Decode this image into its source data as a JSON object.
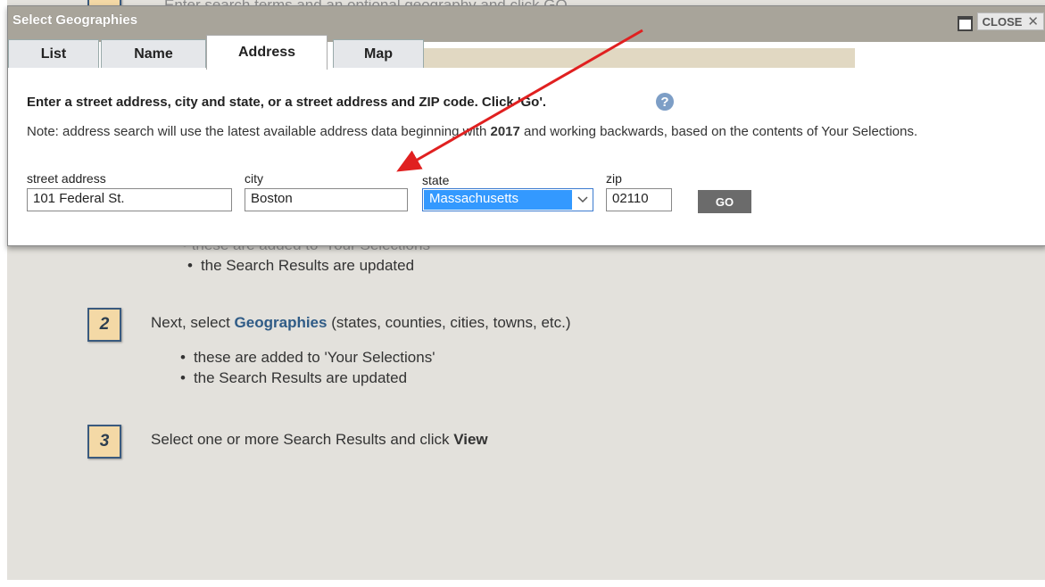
{
  "background": {
    "header_text": "Enter search terms and an optional geography and click GO",
    "step1_faded_bullet": "these are added to 'Your Selections'",
    "step1_bullet2": "the Search Results are updated",
    "step2": {
      "number": "2",
      "text_prefix": "Next, select ",
      "highlight": "Geographies",
      "text_suffix": " (states, counties, cities, towns, etc.)",
      "bullets": [
        "these are added to 'Your Selections'",
        "the Search Results are updated"
      ]
    },
    "step3": {
      "number": "3",
      "text_prefix": "Select one or more Search Results and click ",
      "bold": "View"
    }
  },
  "dialog": {
    "title": "Select Geographies",
    "close_label": "CLOSE",
    "close_x": "✕",
    "tabs": [
      {
        "label": "List",
        "active": false
      },
      {
        "label": "Name",
        "active": false
      },
      {
        "label": "Address",
        "active": true
      },
      {
        "label": "Map",
        "active": false
      }
    ],
    "instructions": "Enter a street address, city and state, or a street address and ZIP code. Click 'Go'.",
    "help_glyph": "?",
    "note_prefix": "Note: address search will use the latest available address data beginning with ",
    "note_year": "2017",
    "note_suffix": " and working backwards, based on the contents of Your Selections.",
    "fields": {
      "street_label": "street address",
      "street_value": "101 Federal St.",
      "city_label": "city",
      "city_value": "Boston",
      "state_label": "state",
      "state_value": "Massachusetts",
      "zip_label": "zip",
      "zip_value": "02110"
    },
    "go_label": "GO"
  },
  "colors": {
    "titlebar": "#a8a49a",
    "link": "#2f5b86",
    "select_highlight": "#3399ff",
    "annotation_arrow": "#e02020"
  }
}
